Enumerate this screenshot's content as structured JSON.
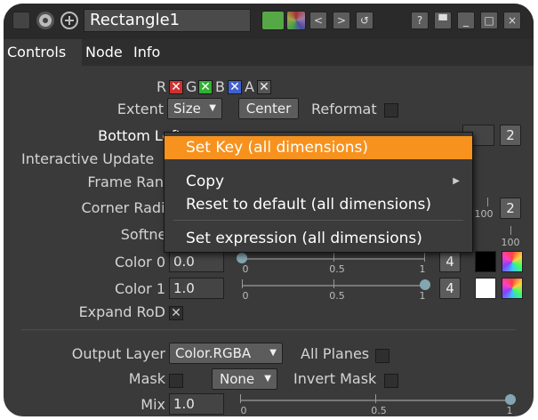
{
  "titlebar": {
    "node_name": "Rectangle1",
    "help_label": "?"
  },
  "tabs": [
    {
      "label": "Controls"
    },
    {
      "label": "Node"
    },
    {
      "label": "Info"
    }
  ],
  "channels": {
    "r": "R",
    "g": "G",
    "b": "B",
    "a": "A"
  },
  "extent": {
    "label": "Extent",
    "value": "Size",
    "center_label": "Center",
    "reformat_label": "Reformat"
  },
  "bottom_left": {
    "label": "Bottom Left",
    "count": "2"
  },
  "interactive_update": {
    "label": "Interactive Update"
  },
  "frame_range": {
    "label": "Frame Range"
  },
  "corner_radius": {
    "label": "Corner Radius",
    "count": "2",
    "tick_label": "100"
  },
  "softness": {
    "label": "Softness",
    "tick_label": "100"
  },
  "color0": {
    "label": "Color 0",
    "value": "0.0",
    "count": "4",
    "ticks": [
      "0",
      "0.5",
      "1"
    ],
    "swatch": "#000000",
    "level": 0.0
  },
  "color1": {
    "label": "Color 1",
    "value": "1.0",
    "count": "4",
    "ticks": [
      "0",
      "0.5",
      "1"
    ],
    "swatch": "#ffffff",
    "level": 1.0
  },
  "expand_rod": {
    "label": "Expand RoD"
  },
  "output_layer": {
    "label": "Output Layer",
    "value": "Color.RGBA",
    "all_planes_label": "All Planes"
  },
  "mask": {
    "label": "Mask",
    "value": "None",
    "invert_label": "Invert Mask"
  },
  "mix": {
    "label": "Mix",
    "value": "1.0",
    "ticks": [
      "0",
      "0.5",
      "1"
    ],
    "level": 1.0
  },
  "context_menu": {
    "items": [
      {
        "label": "Set Key (all dimensions)"
      },
      {
        "label": "Copy"
      },
      {
        "label": "Reset to default (all dimensions)"
      },
      {
        "label": "Set expression (all dimensions)"
      }
    ],
    "highlight_color": "#f7921e"
  },
  "colors": {
    "background": "#3a3a3a",
    "accent": "#f7921e",
    "channel_r": "#e03030",
    "channel_g": "#30d040",
    "channel_b": "#4060e0"
  }
}
